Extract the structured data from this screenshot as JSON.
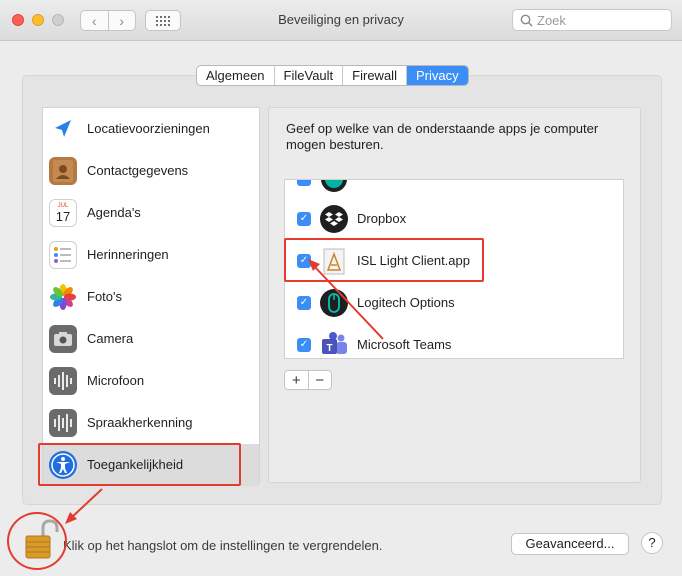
{
  "window": {
    "title": "Beveiliging en privacy",
    "back_glyph": "‹",
    "forward_glyph": "›",
    "search_placeholder": "Zoek"
  },
  "tabs": [
    {
      "label": "Algemeen",
      "active": false
    },
    {
      "label": "FileVault",
      "active": false
    },
    {
      "label": "Firewall",
      "active": false
    },
    {
      "label": "Privacy",
      "active": true
    }
  ],
  "sidebar": {
    "items": [
      {
        "label": "Locatievoorzieningen",
        "icon": "location-arrow-icon"
      },
      {
        "label": "Contactgegevens",
        "icon": "contacts-book-icon"
      },
      {
        "label": "Agenda's",
        "icon": "calendar-icon",
        "icon_month": "JUL",
        "icon_day": "17"
      },
      {
        "label": "Herinneringen",
        "icon": "reminders-list-icon"
      },
      {
        "label": "Foto's",
        "icon": "photos-flower-icon"
      },
      {
        "label": "Camera",
        "icon": "camera-icon"
      },
      {
        "label": "Microfoon",
        "icon": "microphone-waveform-icon"
      },
      {
        "label": "Spraakherkenning",
        "icon": "speech-waveform-icon"
      },
      {
        "label": "Toegankelijkheid",
        "icon": "accessibility-icon",
        "selected": true
      }
    ]
  },
  "main": {
    "description": "Geef op welke van de onderstaande apps je computer mogen besturen.",
    "apps": [
      {
        "label": "Dropbox",
        "checked": true,
        "icon": "dropbox-icon"
      },
      {
        "label": "ISL Light Client.app",
        "checked": true,
        "icon": "isl-light-app-icon"
      },
      {
        "label": "Logitech Options",
        "checked": true,
        "icon": "logitech-options-icon"
      },
      {
        "label": "Microsoft Teams",
        "checked": true,
        "icon": "microsoft-teams-icon"
      }
    ],
    "add_glyph": "+",
    "remove_glyph": "−"
  },
  "footer": {
    "lock_text": "Klik op het hangslot om de instellingen te vergrendelen.",
    "advanced_label": "Geavanceerd...",
    "help_label": "?"
  },
  "colors": {
    "accent": "#3a8ef6",
    "annotation": "#e33b2e"
  }
}
